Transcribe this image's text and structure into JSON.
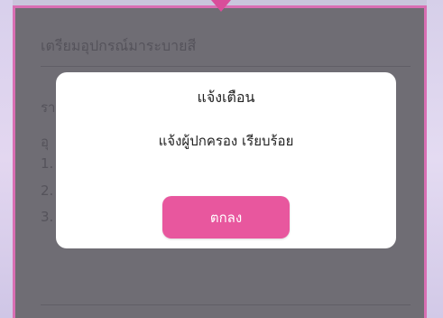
{
  "background_card": {
    "title": "เตรียมอุปกรณ์มาระบายสี",
    "lines": [
      "รา",
      "อุ",
      "1.",
      "2.",
      "3."
    ]
  },
  "dialog": {
    "title": "แจ้งเตือน",
    "message": "แจ้งผู้ปกครอง เรียบร้อย",
    "ok_label": "ตกลง"
  },
  "colors": {
    "accent": "#e8579e",
    "frame": "#d96fb3",
    "overlay": "#6f6d74"
  }
}
